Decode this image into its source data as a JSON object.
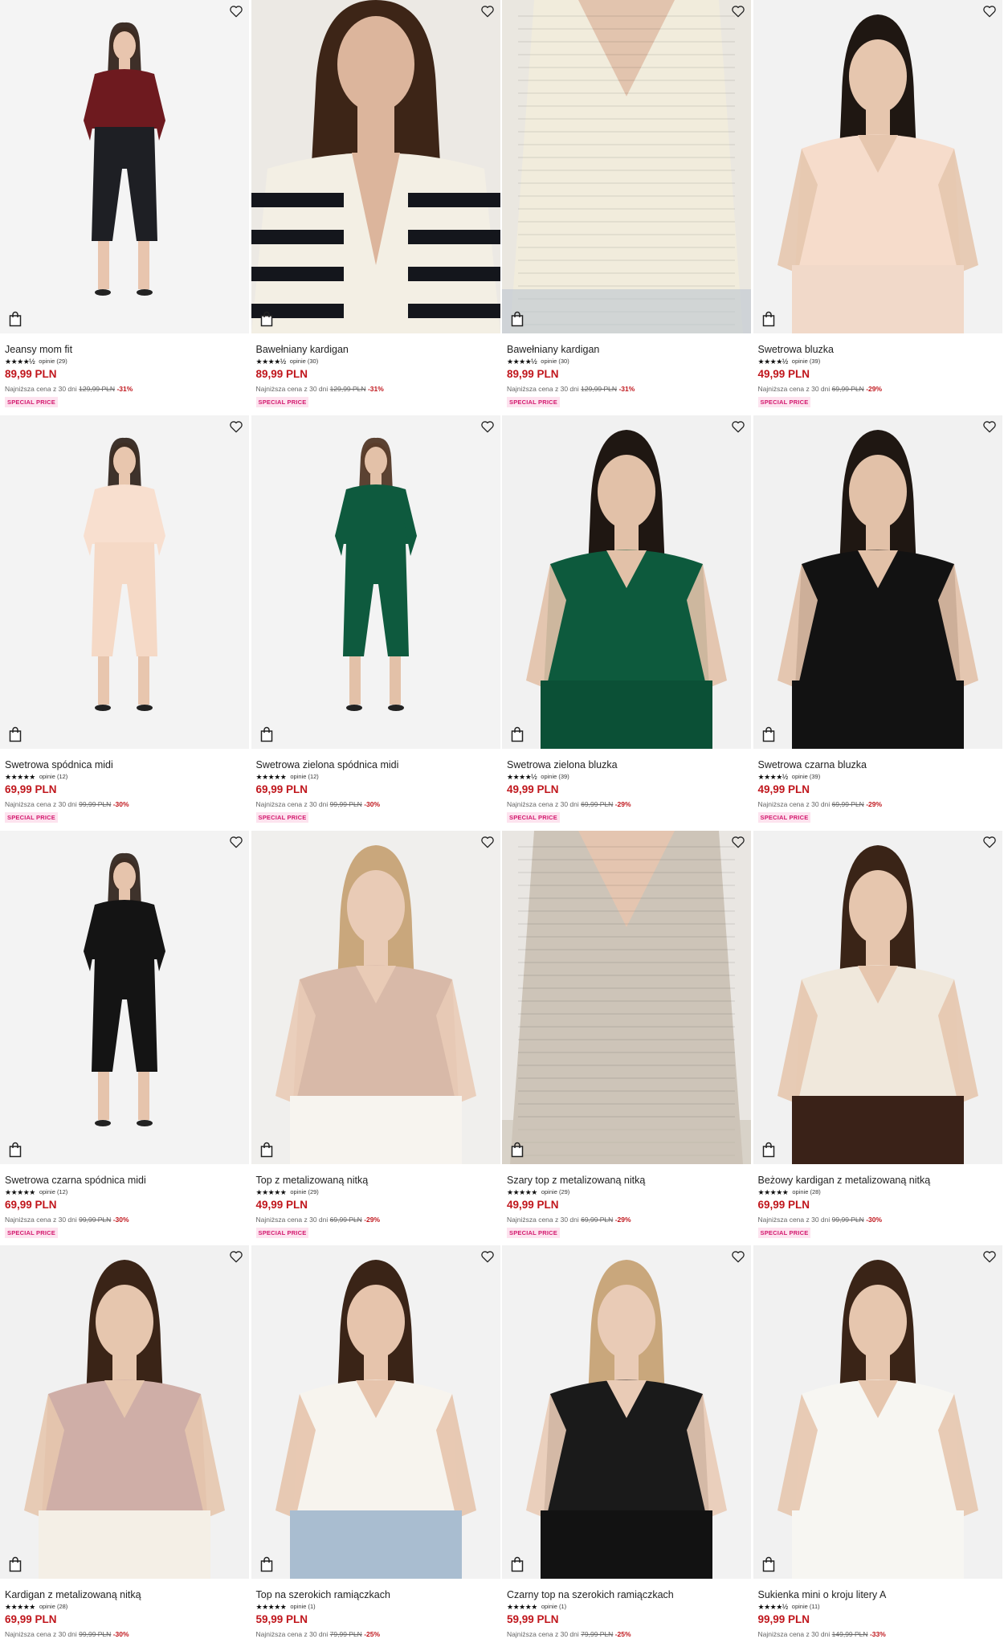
{
  "labels": {
    "lowest_prefix": "Najniższa cena z 30 dni",
    "badge": "SPECIAL PRICE"
  },
  "colors": {
    "price": "#c0161c",
    "badge_bg": "#fde3ef",
    "badge_text": "#d3196e"
  },
  "products": [
    {
      "name": "Jeansy mom fit",
      "stars": "★★★★½",
      "reviews": "opinie (29)",
      "price": "89,99 PLN",
      "old_price": "129,99 PLN",
      "discount": "-31%",
      "badge": true,
      "visual": {
        "bg": "#f4f4f4",
        "top": "#6e1a1f",
        "bottom": "#1e1f24",
        "skin": "#e8c5ae",
        "hair": "#2a1a12",
        "shot": "full"
      }
    },
    {
      "name": "Bawełniany kardigan",
      "stars": "★★★★½",
      "reviews": "opinie (30)",
      "price": "89,99 PLN",
      "old_price": "129,99 PLN",
      "discount": "-31%",
      "badge": true,
      "visual": {
        "bg": "#ece9e4",
        "top": "#f3efe4",
        "bottom": "#14161c",
        "skin": "#dcb59c",
        "hair": "#3d2517",
        "shot": "stripes"
      }
    },
    {
      "name": "Bawełniany kardigan",
      "stars": "★★★★½",
      "reviews": "opinie (30)",
      "price": "89,99 PLN",
      "old_price": "129,99 PLN",
      "discount": "-31%",
      "badge": true,
      "visual": {
        "bg": "#eae7e0",
        "top": "#f1ecdc",
        "bottom": "#bcc6d0",
        "skin": "#e2c4ae",
        "hair": "#3d2517",
        "shot": "detail"
      }
    },
    {
      "name": "Swetrowa bluzka",
      "stars": "★★★★½",
      "reviews": "opinie (39)",
      "price": "49,99 PLN",
      "old_price": "69,99 PLN",
      "discount": "-29%",
      "badge": true,
      "visual": {
        "bg": "#f2f2f2",
        "top": "#f6dccb",
        "bottom": "#f1d9c9",
        "skin": "#e6c6ae",
        "hair": "#1f1712",
        "shot": "half"
      }
    },
    {
      "name": "Swetrowa spódnica midi",
      "stars": "★★★★★",
      "reviews": "opinie (12)",
      "price": "69,99 PLN",
      "old_price": "99,99 PLN",
      "discount": "-30%",
      "badge": true,
      "visual": {
        "bg": "#f3f3f3",
        "top": "#f8dfcf",
        "bottom": "#f5d9c6",
        "skin": "#e8c6ae",
        "hair": "#2a1d15",
        "shot": "full"
      }
    },
    {
      "name": "Swetrowa zielona spódnica midi",
      "stars": "★★★★★",
      "reviews": "opinie (12)",
      "price": "69,99 PLN",
      "old_price": "99,99 PLN",
      "discount": "-30%",
      "badge": true,
      "visual": {
        "bg": "#f3f3f3",
        "top": "#0e5a3e",
        "bottom": "#0e5a3e",
        "skin": "#e3c1a8",
        "hair": "#4a2f1d",
        "shot": "full"
      }
    },
    {
      "name": "Swetrowa zielona bluzka",
      "stars": "★★★★½",
      "reviews": "opinie (39)",
      "price": "49,99 PLN",
      "old_price": "69,99 PLN",
      "discount": "-29%",
      "badge": true,
      "visual": {
        "bg": "#f1f1f1",
        "top": "#0d5a3d",
        "bottom": "#0b5036",
        "skin": "#e2c1a8",
        "hair": "#1f1712",
        "shot": "half"
      }
    },
    {
      "name": "Swetrowa czarna bluzka",
      "stars": "★★★★½",
      "reviews": "opinie (39)",
      "price": "49,99 PLN",
      "old_price": "69,99 PLN",
      "discount": "-29%",
      "badge": true,
      "visual": {
        "bg": "#f1f1f1",
        "top": "#121212",
        "bottom": "#121212",
        "skin": "#e2c1a8",
        "hair": "#1f1712",
        "shot": "half"
      }
    },
    {
      "name": "Swetrowa czarna spódnica midi",
      "stars": "★★★★★",
      "reviews": "opinie (12)",
      "price": "69,99 PLN",
      "old_price": "99,99 PLN",
      "discount": "-30%",
      "badge": true,
      "visual": {
        "bg": "#f3f3f3",
        "top": "#141414",
        "bottom": "#141414",
        "skin": "#e6c4ac",
        "hair": "#2a1d15",
        "shot": "full"
      }
    },
    {
      "name": "Top z metalizowaną nitką",
      "stars": "★★★★★",
      "reviews": "opinie (29)",
      "price": "49,99 PLN",
      "old_price": "69,99 PLN",
      "discount": "-29%",
      "badge": true,
      "visual": {
        "bg": "#f0efed",
        "top": "#d8b9a8",
        "bottom": "#f7f4ef",
        "skin": "#e9cbb6",
        "hair": "#c9a77c",
        "shot": "half"
      }
    },
    {
      "name": "Szary top z metalizowaną nitką",
      "stars": "★★★★★",
      "reviews": "opinie (29)",
      "price": "49,99 PLN",
      "old_price": "69,99 PLN",
      "discount": "-29%",
      "badge": true,
      "visual": {
        "bg": "#e9e6e2",
        "top": "#cdc4b8",
        "bottom": "#cdc4b8",
        "skin": "#e4c5b0",
        "hair": "#c9a77c",
        "shot": "detail"
      }
    },
    {
      "name": "Beżowy kardigan z metalizowaną nitką",
      "stars": "★★★★★",
      "reviews": "opinie (28)",
      "price": "69,99 PLN",
      "old_price": "99,99 PLN",
      "discount": "-30%",
      "badge": true,
      "visual": {
        "bg": "#f1f1f1",
        "top": "#f0e8dc",
        "bottom": "#3a2218",
        "skin": "#e6c6ae",
        "hair": "#3a2417",
        "shot": "half"
      }
    },
    {
      "name": "Kardigan z metalizowaną nitką",
      "stars": "★★★★★",
      "reviews": "opinie (28)",
      "price": "69,99 PLN",
      "old_price": "99,99 PLN",
      "discount": "-30%",
      "badge": false,
      "visual": {
        "bg": "#f1f1f1",
        "top": "#cfaea7",
        "bottom": "#f4efe6",
        "skin": "#e6c6ae",
        "hair": "#3a2417",
        "shot": "half"
      }
    },
    {
      "name": "Top na szerokich ramiączkach",
      "stars": "★★★★★",
      "reviews": "opinie (1)",
      "price": "59,99 PLN",
      "old_price": "79,99 PLN",
      "discount": "-25%",
      "badge": false,
      "visual": {
        "bg": "#f2f2f2",
        "top": "#f7f4ee",
        "bottom": "#a9bdd0",
        "skin": "#e6c4ac",
        "hair": "#3a2417",
        "shot": "half"
      }
    },
    {
      "name": "Czarny top na szerokich ramiączkach",
      "stars": "★★★★★",
      "reviews": "opinie (1)",
      "price": "59,99 PLN",
      "old_price": "79,99 PLN",
      "discount": "-25%",
      "badge": false,
      "visual": {
        "bg": "#f2f2f2",
        "top": "#1a1a1a",
        "bottom": "#121212",
        "skin": "#e9cbb6",
        "hair": "#c9a77c",
        "shot": "half"
      }
    },
    {
      "name": "Sukienka mini o kroju litery A",
      "stars": "★★★★½",
      "reviews": "opinie (11)",
      "price": "99,99 PLN",
      "old_price": "149,99 PLN",
      "discount": "-33%",
      "badge": false,
      "visual": {
        "bg": "#f1f1f1",
        "top": "#f7f6f2",
        "bottom": "#f7f6f2",
        "skin": "#e6c6ae",
        "hair": "#3a2417",
        "shot": "half"
      }
    }
  ]
}
